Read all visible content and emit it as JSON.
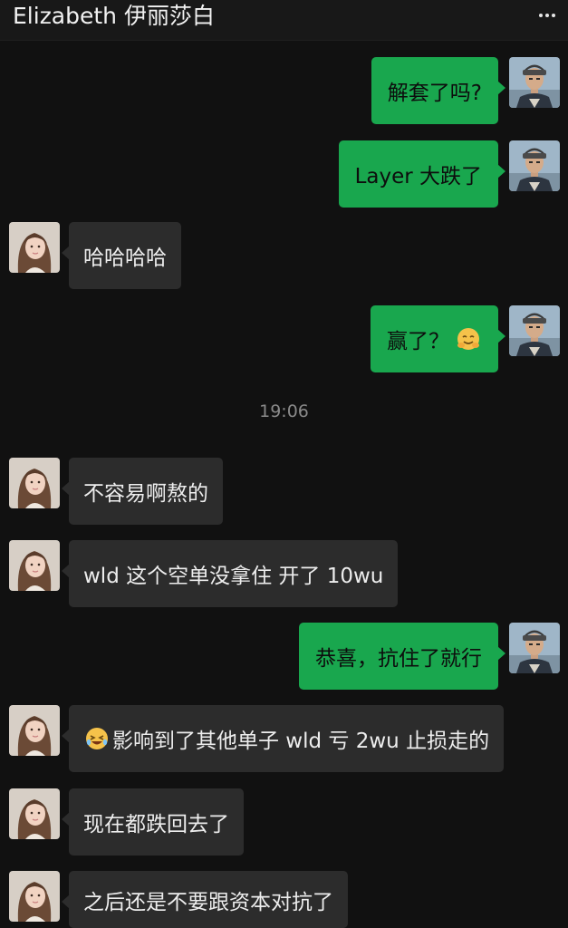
{
  "header": {
    "title": "Elizabeth 伊丽莎白",
    "more_icon": "more-dots-icon"
  },
  "colors": {
    "background": "#111111",
    "outgoing_bubble": "#19a74e",
    "incoming_bubble": "#2c2c2c",
    "timestamp": "#8a8a8a"
  },
  "timestamp": "19:06",
  "messages": [
    {
      "from": "me",
      "text": "解套了吗?"
    },
    {
      "from": "me",
      "text": "Layer 大跌了"
    },
    {
      "from": "her",
      "text": "哈哈哈哈"
    },
    {
      "from": "me",
      "text": "赢了？",
      "trailing_emoji": "hugging-face-emoji"
    },
    {
      "from": "her",
      "text": "不容易啊熬的"
    },
    {
      "from": "her",
      "text": "wld 这个空单没拿住 开了 10wu"
    },
    {
      "from": "me",
      "text": "恭喜，抗住了就行"
    },
    {
      "from": "her",
      "text": "影响到了其他单子 wld 亏 2wu 止损走的",
      "leading_emoji": "rolling-laughing-emoji"
    },
    {
      "from": "her",
      "text": "现在都跌回去了"
    },
    {
      "from": "her",
      "text": "之后还是不要跟资本对抗了"
    }
  ]
}
